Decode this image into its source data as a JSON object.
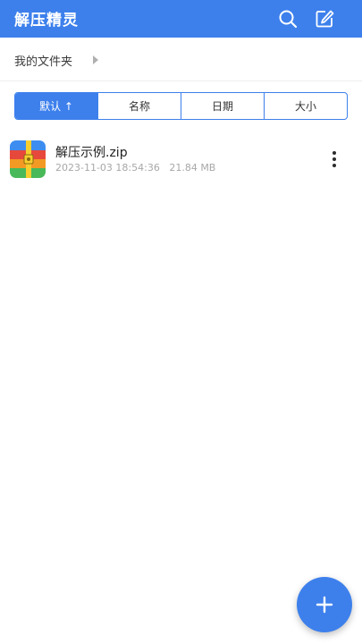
{
  "app_bar": {
    "title": "解压精灵",
    "background": "#3d80ec",
    "search_icon": "search-icon",
    "edit_icon": "edit-icon"
  },
  "breadcrumb": {
    "current": "我的文件夹",
    "arrow_icon": "chevron-right-icon"
  },
  "sort_tabs": [
    {
      "label": "默认 ↑",
      "active": true
    },
    {
      "label": "名称",
      "active": false
    },
    {
      "label": "日期",
      "active": false
    },
    {
      "label": "大小",
      "active": false
    }
  ],
  "files": [
    {
      "name": "解压示例.zip",
      "date": "2023-11-03 18:54:36",
      "size": "21.84 MB",
      "icon": "archive-icon"
    }
  ],
  "fab": {
    "icon": "plus-icon"
  }
}
